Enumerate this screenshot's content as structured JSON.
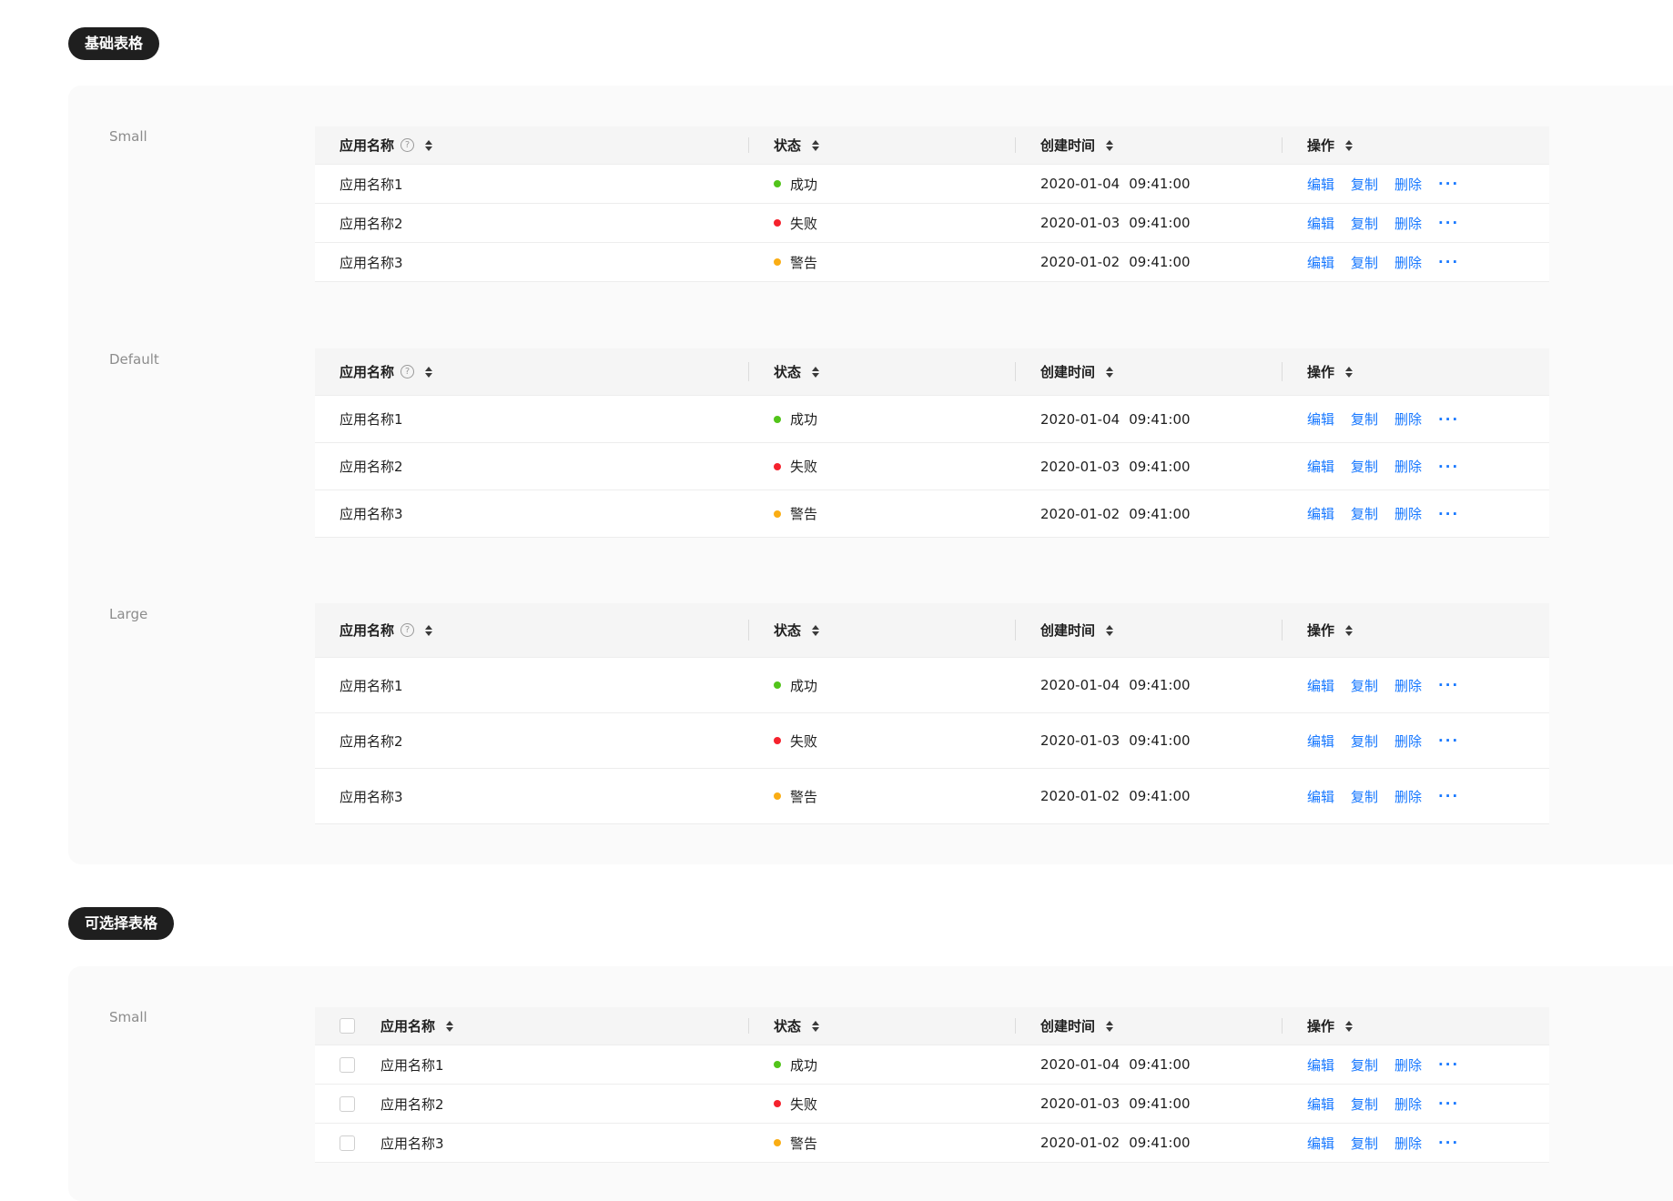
{
  "sections": {
    "basic_title": "基础表格",
    "selectable_title": "可选择表格"
  },
  "size_labels": {
    "small": "Small",
    "default": "Default",
    "large": "Large",
    "selectable_small": "Small"
  },
  "columns": {
    "name": "应用名称",
    "status": "状态",
    "created": "创建时间",
    "actions": "操作"
  },
  "help_icon": "question-circle-icon",
  "rows": [
    {
      "name": "应用名称1",
      "status": "成功",
      "status_color": "#52c41a",
      "date": "2020-01-04",
      "time": "09:41:00"
    },
    {
      "name": "应用名称2",
      "status": "失败",
      "status_color": "#f5222d",
      "date": "2020-01-03",
      "time": "09:41:00"
    },
    {
      "name": "应用名称3",
      "status": "警告",
      "status_color": "#faad14",
      "date": "2020-01-02",
      "time": "09:41:00"
    }
  ],
  "actions": {
    "edit": "编辑",
    "copy": "复制",
    "delete": "删除",
    "more": "···"
  },
  "colors": {
    "link": "#1677ff",
    "pill_bg": "#1f1f1f",
    "header_bg": "#f5f5f5"
  }
}
